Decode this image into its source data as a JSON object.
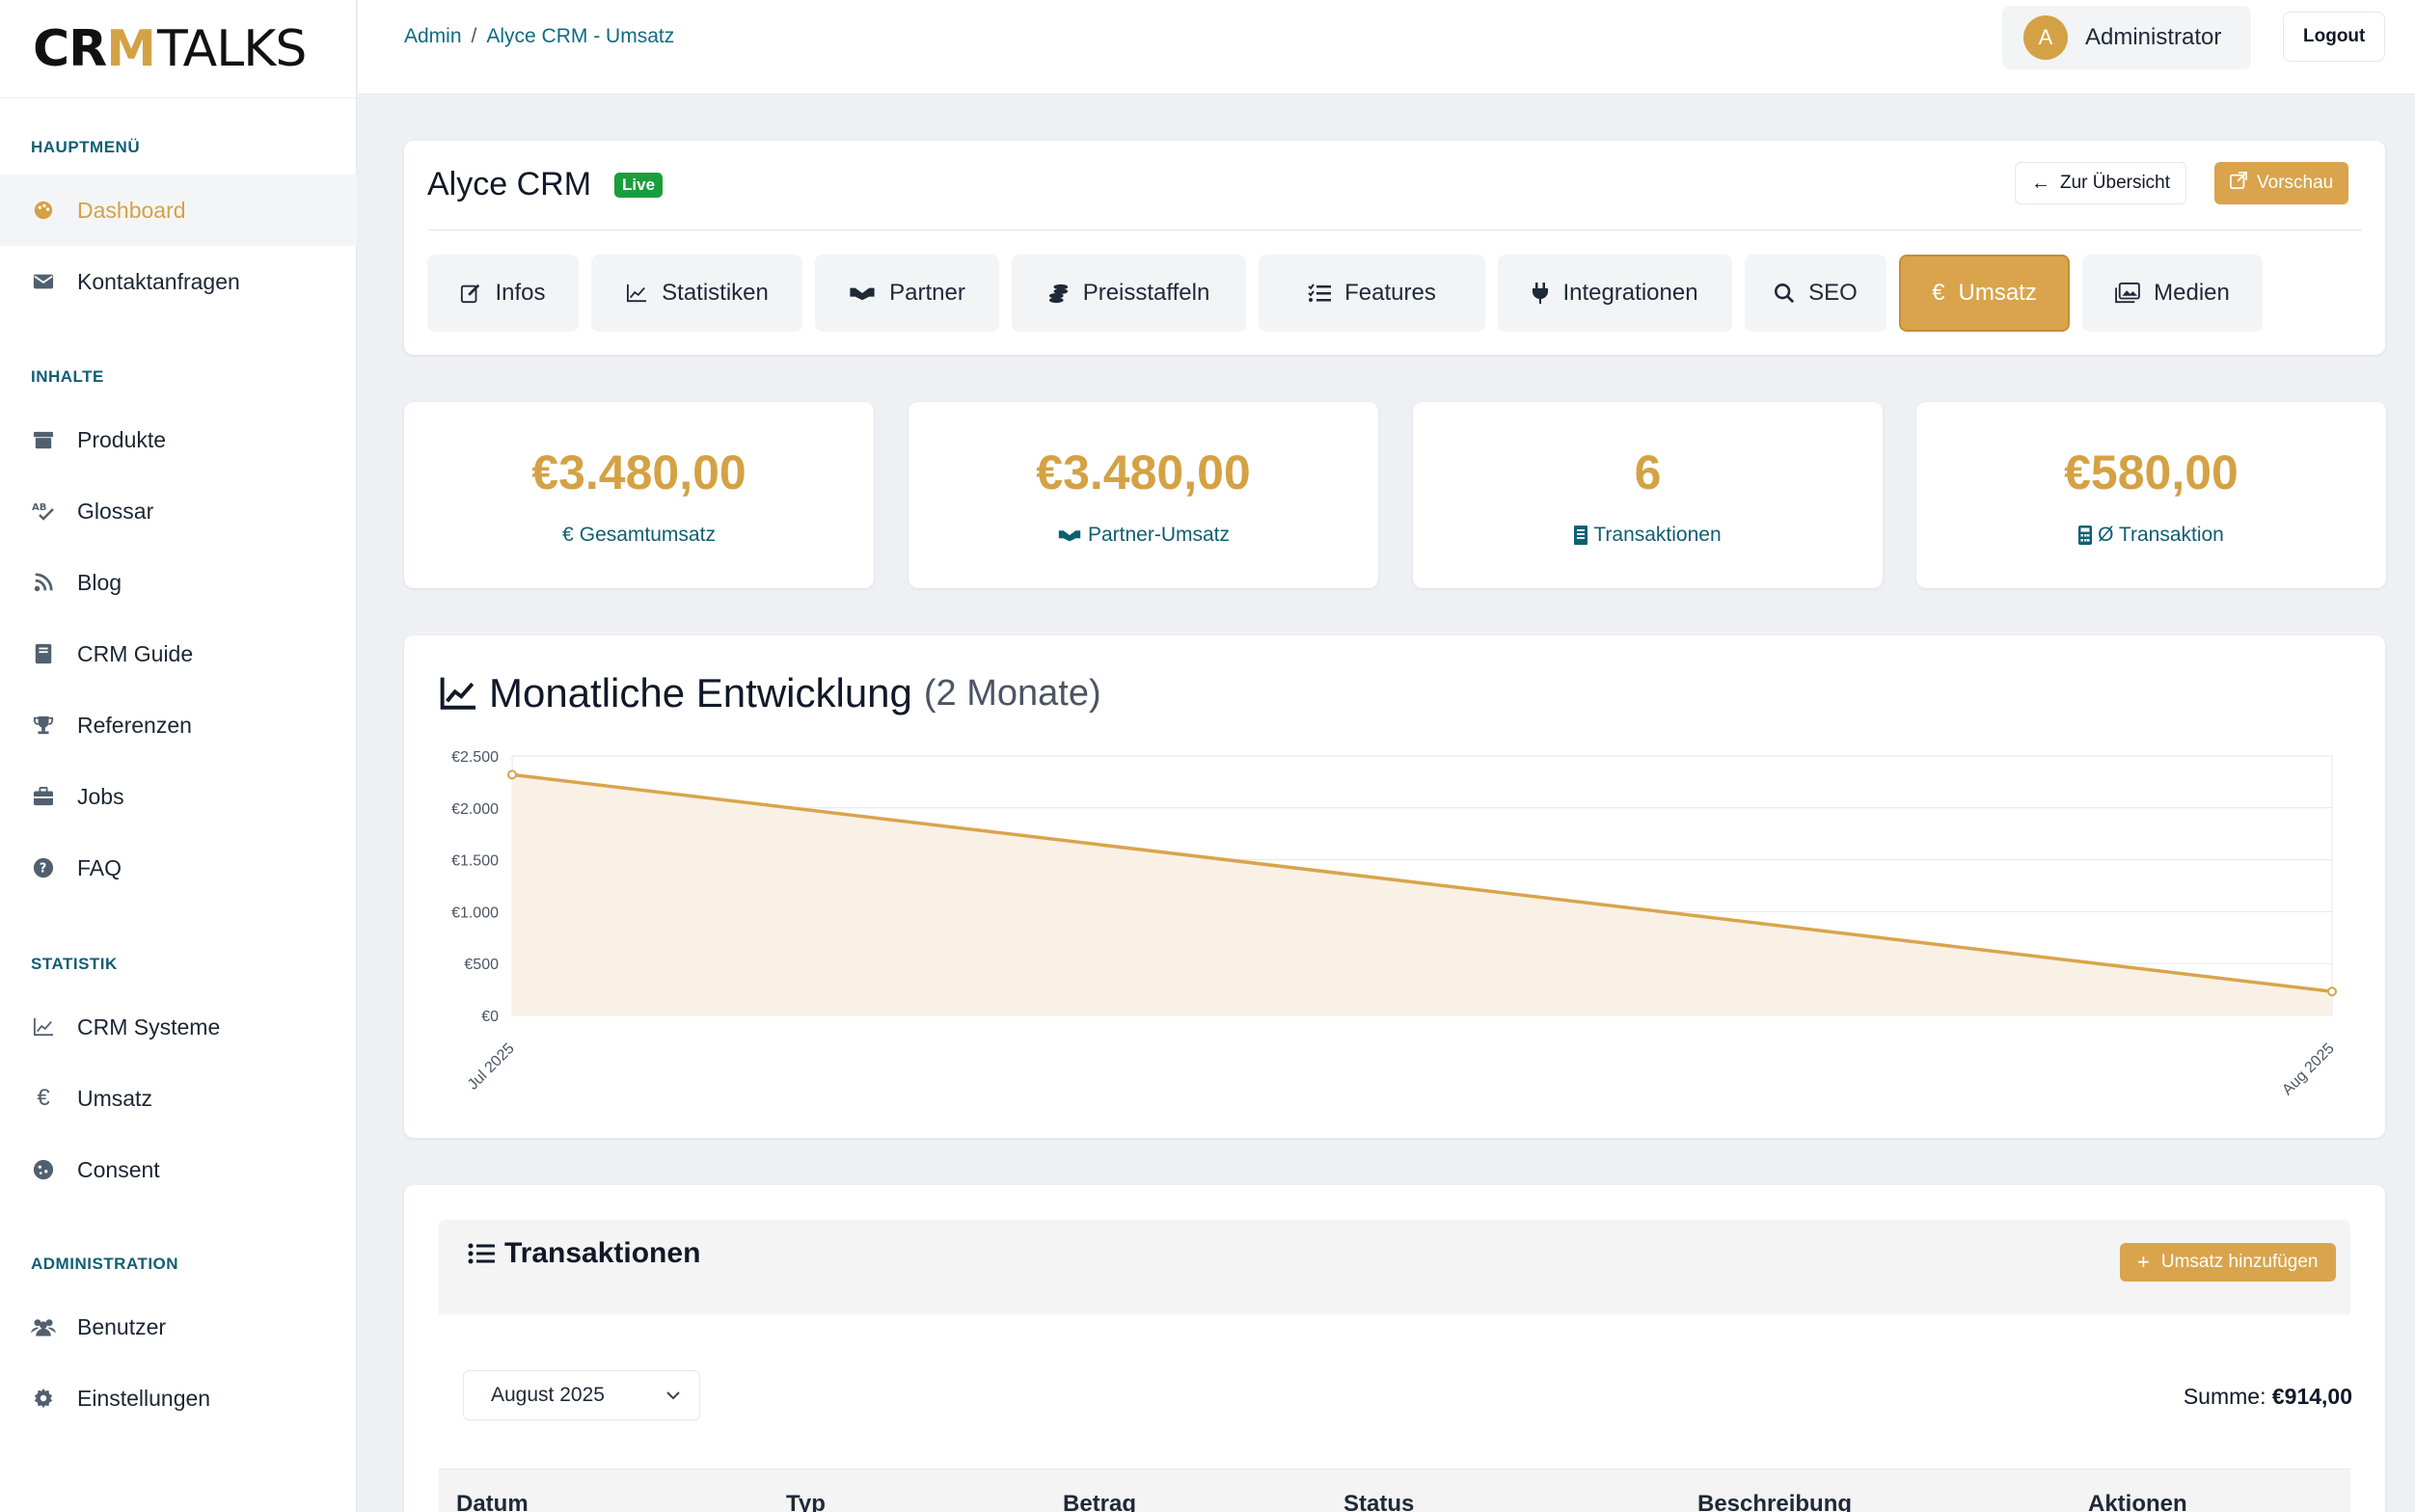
{
  "logo": {
    "part1": "CR",
    "part2": "M",
    "part3": "TALKS"
  },
  "sidebar": {
    "sections": [
      {
        "title": "HAUPTMENÜ"
      },
      {
        "title": "INHALTE"
      },
      {
        "title": "STATISTIK"
      },
      {
        "title": "ADMINISTRATION"
      }
    ],
    "items": [
      {
        "label": "Dashboard",
        "icon": "palette-icon"
      },
      {
        "label": "Kontaktanfragen",
        "icon": "envelope-icon"
      },
      {
        "label": "Produkte",
        "icon": "box-icon"
      },
      {
        "label": "Glossar",
        "icon": "spellcheck-icon"
      },
      {
        "label": "Blog",
        "icon": "rss-icon"
      },
      {
        "label": "CRM Guide",
        "icon": "book-icon"
      },
      {
        "label": "Referenzen",
        "icon": "trophy-icon"
      },
      {
        "label": "Jobs",
        "icon": "briefcase-icon"
      },
      {
        "label": "FAQ",
        "icon": "question-circle-icon"
      },
      {
        "label": "CRM Systeme",
        "icon": "line-chart-icon"
      },
      {
        "label": "Umsatz",
        "icon": "euro-icon"
      },
      {
        "label": "Consent",
        "icon": "cookie-icon"
      },
      {
        "label": "Benutzer",
        "icon": "users-icon"
      },
      {
        "label": "Einstellungen",
        "icon": "gear-icon"
      }
    ]
  },
  "topbar": {
    "breadcrumb": [
      "Admin",
      "Alyce CRM - Umsatz"
    ],
    "breadcrumb_sep": "/",
    "user_initial": "A",
    "user_name": "Administrator",
    "logout": "Logout"
  },
  "header": {
    "title": "Alyce CRM",
    "badge": "Live",
    "back_label": "Zur Übersicht",
    "preview_label": "Vorschau",
    "tabs": [
      {
        "label": "Infos",
        "icon": "edit-icon"
      },
      {
        "label": "Statistiken",
        "icon": "line-chart-icon"
      },
      {
        "label": "Partner",
        "icon": "handshake-icon"
      },
      {
        "label": "Preisstaffeln",
        "icon": "coins-icon"
      },
      {
        "label": "Features",
        "icon": "list-check-icon"
      },
      {
        "label": "Integrationen",
        "icon": "plug-icon"
      },
      {
        "label": "SEO",
        "icon": "search-icon"
      },
      {
        "label": "Umsatz",
        "icon": "euro-icon",
        "active": true
      },
      {
        "label": "Medien",
        "icon": "images-icon"
      }
    ]
  },
  "stats": [
    {
      "value": "€3.480,00",
      "label": "Gesamtumsatz",
      "icon": "euro-icon"
    },
    {
      "value": "€3.480,00",
      "label": "Partner-Umsatz",
      "icon": "handshake-icon"
    },
    {
      "value": "6",
      "label": "Transaktionen",
      "icon": "receipt-icon"
    },
    {
      "value": "€580,00",
      "label": "Ø Transaktion",
      "icon": "calculator-icon"
    }
  ],
  "chart": {
    "title": "Monatliche Entwicklung",
    "subtitle": "(2 Monate)"
  },
  "chart_data": {
    "type": "area",
    "categories": [
      "Jul 2025",
      "Aug 2025"
    ],
    "series": [
      {
        "values": [
          2320,
          230
        ]
      }
    ],
    "ylim": [
      0,
      2500
    ],
    "yticks": [
      "€0",
      "€500",
      "€1.000",
      "€1.500",
      "€2.000",
      "€2.500"
    ],
    "ytick_values": [
      0,
      500,
      1000,
      1500,
      2000,
      2500
    ],
    "grid": true,
    "line_color": "#d9a44c",
    "fill_color": "#f9f1e5"
  },
  "transactions": {
    "title": "Transaktionen",
    "add_label": "Umsatz hinzufügen",
    "month": "August 2025",
    "sum_label": "Summe:",
    "sum_value": "€914,00",
    "columns": [
      "Datum",
      "Typ",
      "Betrag",
      "Status",
      "Beschreibung",
      "Aktionen"
    ]
  },
  "colors": {
    "accent": "#d4a245",
    "teal": "#0f5f73",
    "live": "#1a9e3d"
  }
}
